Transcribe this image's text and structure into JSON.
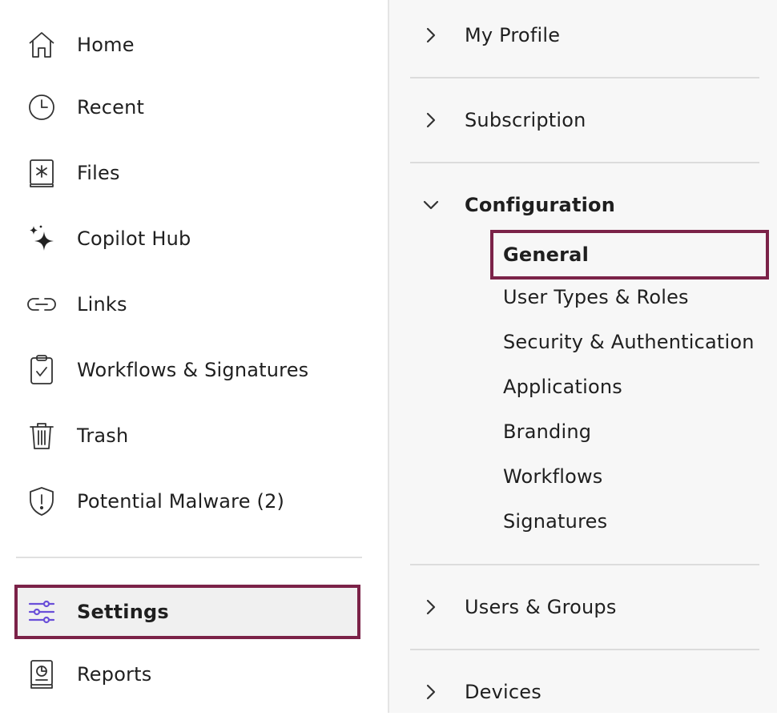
{
  "sidebar": {
    "items": [
      {
        "label": "Home",
        "icon": "home-icon"
      },
      {
        "label": "Recent",
        "icon": "clock-icon"
      },
      {
        "label": "Files",
        "icon": "files-icon"
      },
      {
        "label": "Copilot Hub",
        "icon": "sparkle-icon"
      },
      {
        "label": "Links",
        "icon": "link-icon"
      },
      {
        "label": "Workflows & Signatures",
        "icon": "clipboard-check-icon"
      },
      {
        "label": "Trash",
        "icon": "trash-icon"
      },
      {
        "label": "Potential Malware (2)",
        "icon": "shield-alert-icon"
      }
    ],
    "settings": {
      "label": "Settings",
      "icon": "sliders-icon",
      "active": true
    },
    "reports": {
      "label": "Reports",
      "icon": "reports-icon"
    }
  },
  "settings_panel": {
    "sections": [
      {
        "label": "My Profile",
        "expanded": false
      },
      {
        "label": "Subscription",
        "expanded": false
      },
      {
        "label": "Configuration",
        "expanded": true
      },
      {
        "label": "Users & Groups",
        "expanded": false
      },
      {
        "label": "Devices",
        "expanded": false
      }
    ],
    "configuration_items": [
      {
        "label": "General",
        "active": true
      },
      {
        "label": "User Types & Roles"
      },
      {
        "label": "Security & Authentication"
      },
      {
        "label": "Applications"
      },
      {
        "label": "Branding"
      },
      {
        "label": "Workflows"
      },
      {
        "label": "Signatures"
      }
    ]
  },
  "colors": {
    "highlight_border": "#7b2248",
    "settings_icon": "#6a4fd8",
    "panel_bg": "#f7f7f7"
  }
}
